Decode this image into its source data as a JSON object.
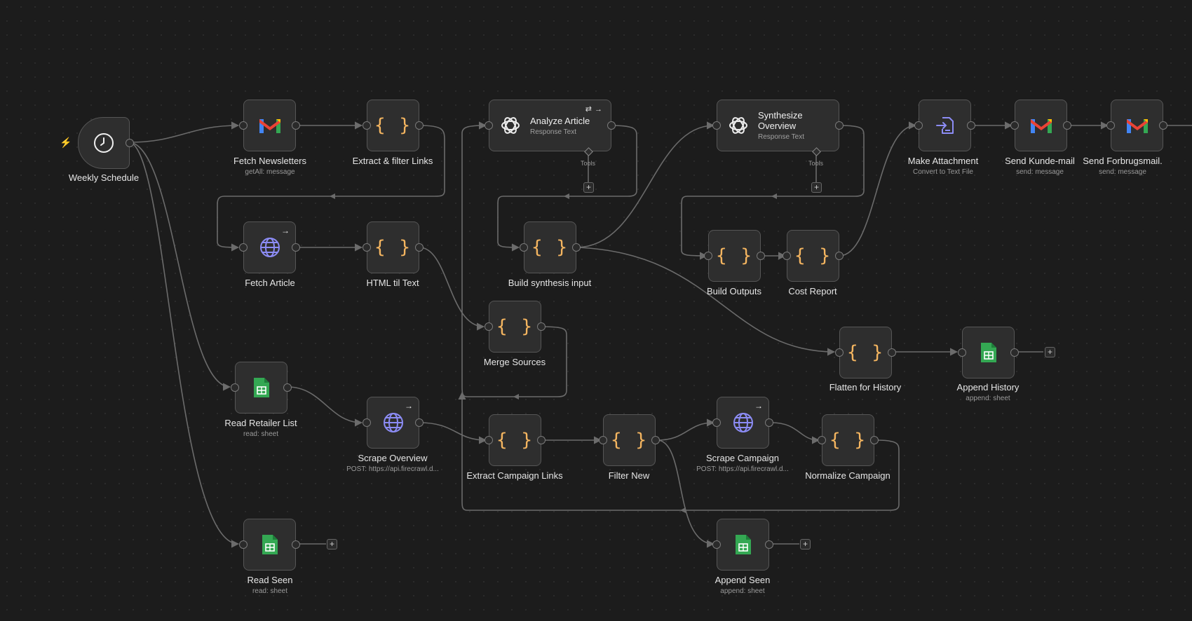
{
  "canvas": {
    "trigger_icon": "lightning-bolt-icon",
    "colors": {
      "background": "#1c1c1c",
      "node": "#2e2e2e",
      "code": "#f4b560",
      "http": "#8c8cf5",
      "sheets": "#34a853"
    }
  },
  "nodes": {
    "weekly_schedule": {
      "label": "Weekly Schedule",
      "icon": "clock-icon"
    },
    "fetch_newsletters": {
      "label": "Fetch Newsletters",
      "sublabel": "getAll: message",
      "icon": "gmail-icon"
    },
    "extract_filter_links": {
      "label": "Extract & filter Links",
      "icon": "code-braces-icon",
      "glyph": "{ }"
    },
    "analyze_article": {
      "title": "Analyze Article",
      "subtitle": "Response Text",
      "icon": "openai-icon",
      "tools_label": "Tools"
    },
    "synthesize_overview": {
      "title_line1": "Synthesize",
      "title_line2": "Overview",
      "subtitle": "Response Text",
      "icon": "openai-icon",
      "tools_label": "Tools"
    },
    "make_attachment": {
      "label": "Make Attachment",
      "sublabel": "Convert to Text File",
      "icon": "file-convert-icon"
    },
    "send_kunde_mail": {
      "label": "Send Kunde-mail",
      "sublabel": "send: message",
      "icon": "gmail-icon"
    },
    "send_forbrugsmail": {
      "label": "Send Forbrugsmail.",
      "sublabel": "send: message",
      "icon": "gmail-icon"
    },
    "fetch_article": {
      "label": "Fetch Article",
      "icon": "globe-icon"
    },
    "html_til_text": {
      "label": "HTML til Text",
      "icon": "code-braces-icon",
      "glyph": "{ }"
    },
    "build_synthesis_input": {
      "label": "Build synthesis input",
      "icon": "code-braces-icon",
      "glyph": "{ }"
    },
    "build_outputs": {
      "label": "Build Outputs",
      "icon": "code-braces-icon",
      "glyph": "{ }"
    },
    "cost_report": {
      "label": "Cost Report",
      "icon": "code-braces-icon",
      "glyph": "{ }"
    },
    "merge_sources": {
      "label": "Merge Sources",
      "icon": "code-braces-icon",
      "glyph": "{ }"
    },
    "flatten_for_history": {
      "label": "Flatten for History",
      "icon": "code-braces-icon",
      "glyph": "{ }"
    },
    "append_history": {
      "label": "Append History",
      "sublabel": "append: sheet",
      "icon": "google-sheets-icon"
    },
    "read_retailer_list": {
      "label": "Read Retailer List",
      "sublabel": "read: sheet",
      "icon": "google-sheets-icon"
    },
    "scrape_overview": {
      "label": "Scrape Overview",
      "sublabel": "POST: https://api.firecrawl.d...",
      "icon": "globe-icon"
    },
    "extract_campaign_links": {
      "label": "Extract Campaign Links",
      "icon": "code-braces-icon",
      "glyph": "{ }"
    },
    "filter_new": {
      "label": "Filter New",
      "icon": "code-braces-icon",
      "glyph": "{ }"
    },
    "scrape_campaign": {
      "label": "Scrape Campaign",
      "sublabel": "POST: https://api.firecrawl.d...",
      "icon": "globe-icon"
    },
    "normalize_campaign": {
      "label": "Normalize Campaign",
      "icon": "code-braces-icon",
      "glyph": "{ }"
    },
    "read_seen": {
      "label": "Read Seen",
      "sublabel": "read: sheet",
      "icon": "google-sheets-icon"
    },
    "append_seen": {
      "label": "Append Seen",
      "sublabel": "append: sheet",
      "icon": "google-sheets-icon"
    }
  },
  "add_button": {
    "glyph": "+"
  }
}
